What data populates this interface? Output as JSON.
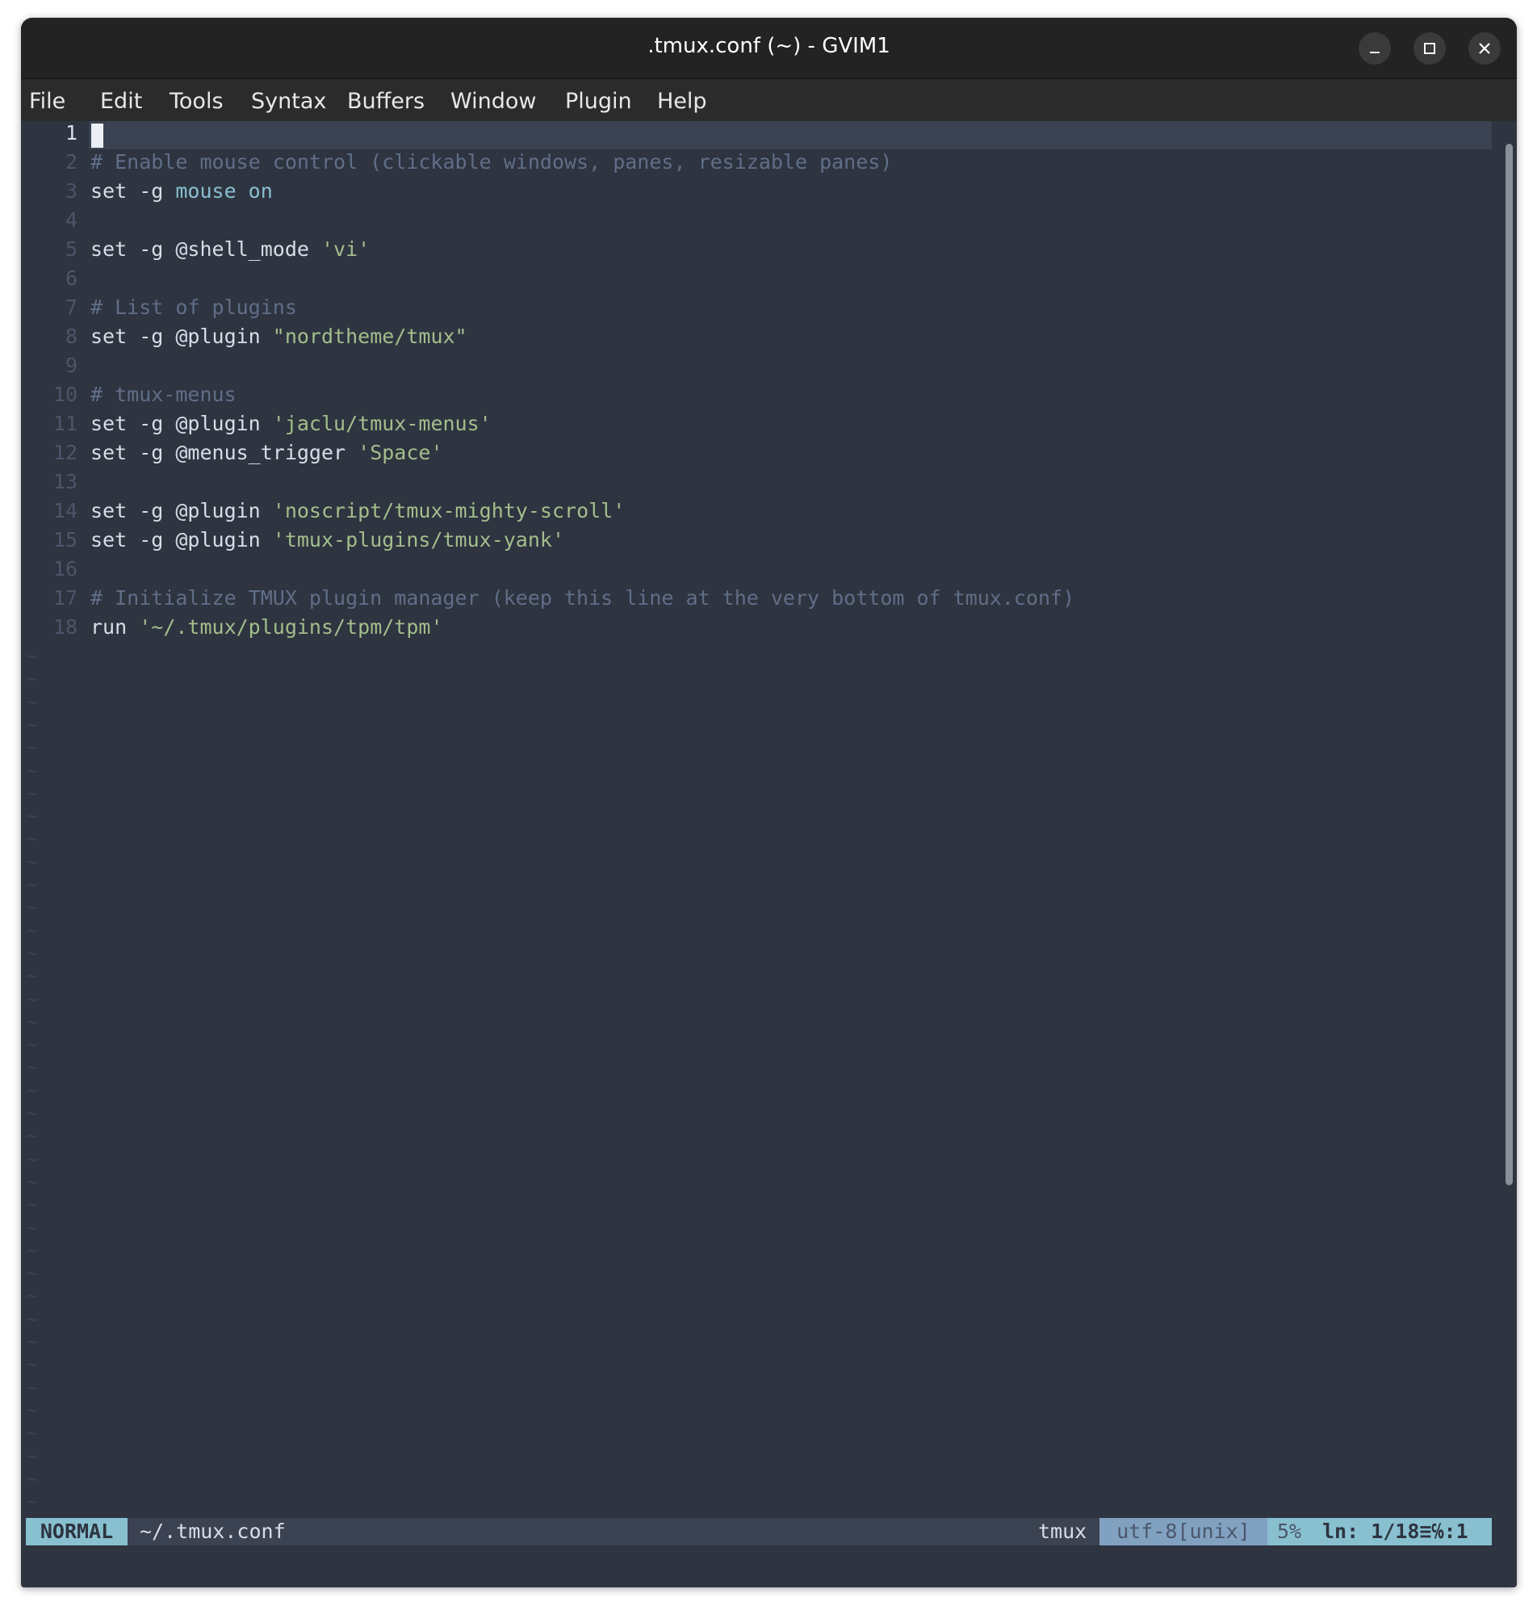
{
  "window": {
    "title": ".tmux.conf (~) - GVIM1"
  },
  "menu": [
    "File",
    "Edit",
    "Tools",
    "Syntax",
    "Buffers",
    "Window",
    "Plugin",
    "Help"
  ],
  "colors": {
    "background": "#2e3440",
    "comment": "#616e88",
    "keyword": "#88c0d0",
    "string": "#a3be8c",
    "text": "#d8dee9"
  },
  "editor": {
    "cursor_line": 1,
    "lines": [
      {
        "n": "1",
        "tokens": []
      },
      {
        "n": "2",
        "tokens": [
          {
            "t": "# Enable mouse control (clickable windows, panes, resizable panes)",
            "c": "comment"
          }
        ]
      },
      {
        "n": "3",
        "tokens": [
          {
            "t": "set -g ",
            "c": "plain"
          },
          {
            "t": "mouse on",
            "c": "kw"
          }
        ]
      },
      {
        "n": "4",
        "tokens": []
      },
      {
        "n": "5",
        "tokens": [
          {
            "t": "set -g @shell_mode ",
            "c": "plain"
          },
          {
            "t": "'vi'",
            "c": "str"
          }
        ]
      },
      {
        "n": "6",
        "tokens": []
      },
      {
        "n": "7",
        "tokens": [
          {
            "t": "# List of plugins",
            "c": "comment"
          }
        ]
      },
      {
        "n": "8",
        "tokens": [
          {
            "t": "set -g @plugin ",
            "c": "plain"
          },
          {
            "t": "\"nordtheme/tmux\"",
            "c": "str"
          }
        ]
      },
      {
        "n": "9",
        "tokens": []
      },
      {
        "n": "10",
        "tokens": [
          {
            "t": "# tmux-menus",
            "c": "comment"
          }
        ]
      },
      {
        "n": "11",
        "tokens": [
          {
            "t": "set -g @plugin ",
            "c": "plain"
          },
          {
            "t": "'jaclu/tmux-menus'",
            "c": "str"
          }
        ]
      },
      {
        "n": "12",
        "tokens": [
          {
            "t": "set -g @menus_trigger ",
            "c": "plain"
          },
          {
            "t": "'Space'",
            "c": "str"
          }
        ]
      },
      {
        "n": "13",
        "tokens": []
      },
      {
        "n": "14",
        "tokens": [
          {
            "t": "set -g @plugin ",
            "c": "plain"
          },
          {
            "t": "'noscript/tmux-mighty-scroll'",
            "c": "str"
          }
        ]
      },
      {
        "n": "15",
        "tokens": [
          {
            "t": "set -g @plugin ",
            "c": "plain"
          },
          {
            "t": "'tmux-plugins/tmux-yank'",
            "c": "str"
          }
        ]
      },
      {
        "n": "16",
        "tokens": []
      },
      {
        "n": "17",
        "tokens": [
          {
            "t": "# Initialize TMUX plugin manager (keep this line at the very bottom of tmux.conf)",
            "c": "comment"
          }
        ]
      },
      {
        "n": "18",
        "tokens": [
          {
            "t": "run ",
            "c": "plain"
          },
          {
            "t": "'~/.tmux/plugins/tpm/tpm'",
            "c": "str"
          }
        ]
      }
    ],
    "filler_char": "~"
  },
  "statusline": {
    "mode": "NORMAL",
    "file": "~/.tmux.conf",
    "filetype": "tmux",
    "encoding": "utf-8[unix]",
    "percent": "5%",
    "position": "ln: 1/18≡℅:1"
  },
  "icons": {
    "minimize": "minimize-icon",
    "maximize": "maximize-icon",
    "close": "close-icon"
  }
}
